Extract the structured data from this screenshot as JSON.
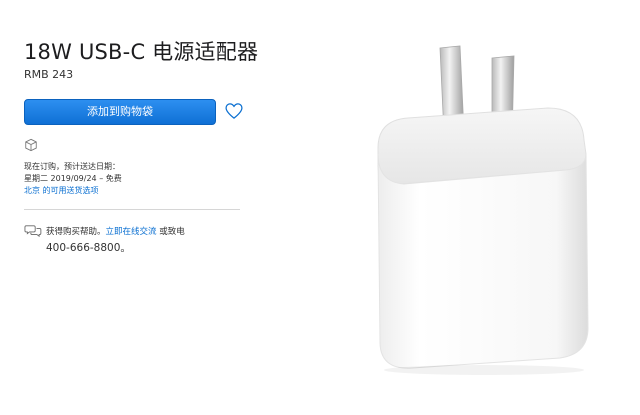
{
  "product": {
    "title": "18W USB-C 电源适配器",
    "price": "RMB 243"
  },
  "actions": {
    "add_to_bag_label": "添加到购物袋",
    "favorite_icon": "heart-icon"
  },
  "delivery": {
    "icon": "box-icon",
    "line1": "现在订购，预计送达日期：",
    "line2": "星期二 2019/09/24 – 免费",
    "link": "北京 的可用送货选项"
  },
  "help": {
    "icon": "chat-bubbles-icon",
    "prefix": "获得购买帮助。",
    "chat_link": "立即在线交流",
    "suffix": " 或致电",
    "phone": "400-666-8800。"
  },
  "colors": {
    "accent": "#0a6fd1",
    "button": "#1a7ee0"
  }
}
